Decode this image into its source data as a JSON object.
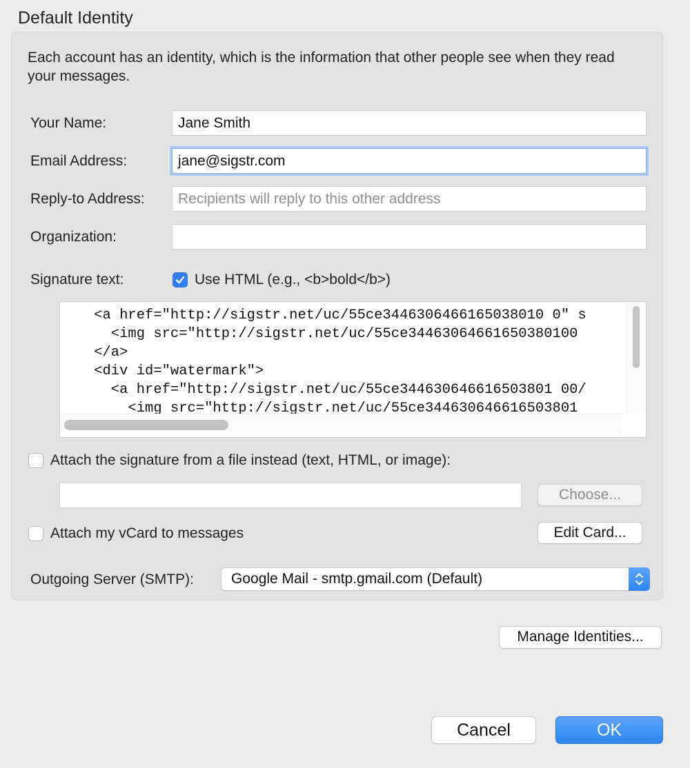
{
  "section": {
    "title": "Default Identity",
    "intro": "Each account has an identity, which is the information that other people see when they read your messages."
  },
  "fields": {
    "name": {
      "label": "Your Name:",
      "value": "Jane Smith"
    },
    "email": {
      "label": "Email Address:",
      "value": "jane@sigstr.com"
    },
    "reply_to": {
      "label": "Reply-to Address:",
      "value": "",
      "placeholder": "Recipients will reply to this other address"
    },
    "organization": {
      "label": "Organization:",
      "value": ""
    }
  },
  "signature": {
    "label": "Signature text:",
    "use_html_label": "Use HTML (e.g., <b>bold</b>)",
    "use_html_checked": true,
    "code_lines": [
      "    <a href=\"http://sigstr.net/uc/55ce3446306466165038010 0\" s",
      "      <img src=\"http://sigstr.net/uc/55ce34463064661650380100",
      "    </a>",
      "    <div id=\"watermark\">",
      "      <a href=\"http://sigstr.net/uc/55ce344630646616503801 00/",
      "        <img src=\"http://sigstr.net/uc/55ce344630646616503801"
    ]
  },
  "attach_file": {
    "label": "Attach the signature from a file instead (text, HTML, or image):",
    "checked": false,
    "path_value": "",
    "choose_label": "Choose..."
  },
  "vcard": {
    "label": "Attach my vCard to messages",
    "checked": false,
    "edit_label": "Edit Card..."
  },
  "smtp": {
    "label": "Outgoing Server (SMTP):",
    "selected": "Google Mail - smtp.gmail.com (Default)"
  },
  "manage_identities_label": "Manage Identities...",
  "dialog": {
    "cancel_label": "Cancel",
    "ok_label": "OK"
  },
  "colors": {
    "accent": "#2f7ff0",
    "focus_ring": "#a9c8f2",
    "window_bg": "#ececec"
  }
}
